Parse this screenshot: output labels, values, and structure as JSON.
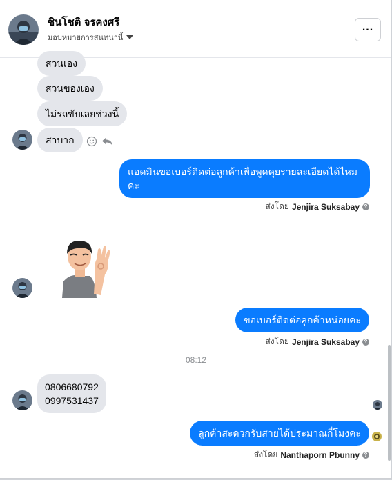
{
  "header": {
    "name": "ชินโชติ จรคงศรี",
    "assign_label": "มอบหมายการสนทนานี้",
    "more_label": "..."
  },
  "messages": {
    "in_1": "สวนเอง",
    "in_2": "สวนของเอง",
    "in_3": "ไม่รถขับเลยช่วงนี้",
    "in_4": "สาบาก",
    "out_1_line1": "แอดมินขอเบอร์ติดต่อลูกค้าเพื่อพูดคุยรายละเอียดได้ไหม",
    "out_1_line2": "คะ",
    "out_1_sent_prefix": "ส่งโดย",
    "out_1_sent_name": "Jenjira Suksabay",
    "out_2": "ขอเบอร์ติดต่อลูกค้าหน่อยคะ",
    "out_2_sent_prefix": "ส่งโดย",
    "out_2_sent_name": "Jenjira Suksabay",
    "timestamp": "08:12",
    "in_5_line1": "0806680792",
    "in_5_line2": "0997531437",
    "out_3": "ลูกค้าสะดวกรับสายได้ประมาณกี่โมงคะ",
    "out_3_sent_prefix": "ส่งโดย",
    "out_3_sent_name": "Nanthaporn Pbunny"
  },
  "icons": {
    "react": "smiley-icon",
    "reply": "reply-icon",
    "help": "question-icon",
    "more": "more-icon"
  },
  "colors": {
    "outgoing": "#0a7cff",
    "incoming": "#e4e6eb"
  }
}
